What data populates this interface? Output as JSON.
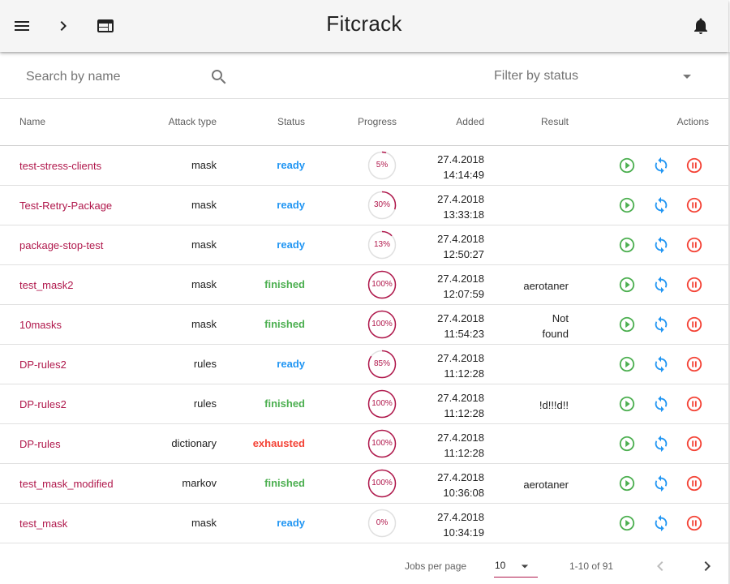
{
  "app": {
    "title": "Fitcrack"
  },
  "toolbar": {
    "menu_icon": "menu-icon",
    "expand_icon": "chevron-right-icon",
    "window_icon": "web-window-icon",
    "notifications_icon": "bell-icon"
  },
  "filters": {
    "search_placeholder": "Search by name",
    "search_value": "",
    "status_placeholder": "Filter by status"
  },
  "table": {
    "headers": {
      "name": "Name",
      "attack_type": "Attack type",
      "status": "Status",
      "progress": "Progress",
      "added": "Added",
      "result": "Result",
      "actions": "Actions"
    },
    "rows": [
      {
        "name": "test-stress-clients",
        "attack": "mask",
        "status": "ready",
        "progress": 5,
        "progress_label": "5%",
        "added_date": "27.4.2018",
        "added_time": "14:14:49",
        "result": [
          "",
          ""
        ]
      },
      {
        "name": "Test-Retry-Package",
        "attack": "mask",
        "status": "ready",
        "progress": 30,
        "progress_label": "30%",
        "added_date": "27.4.2018",
        "added_time": "13:33:18",
        "result": [
          "",
          ""
        ]
      },
      {
        "name": "package-stop-test",
        "attack": "mask",
        "status": "ready",
        "progress": 13,
        "progress_label": "13%",
        "added_date": "27.4.2018",
        "added_time": "12:50:27",
        "result": [
          "",
          ""
        ]
      },
      {
        "name": "test_mask2",
        "attack": "mask",
        "status": "finished",
        "progress": 100,
        "progress_label": "100%",
        "added_date": "27.4.2018",
        "added_time": "12:07:59",
        "result": [
          "aerotaner",
          ""
        ]
      },
      {
        "name": "10masks",
        "attack": "mask",
        "status": "finished",
        "progress": 100,
        "progress_label": "100%",
        "added_date": "27.4.2018",
        "added_time": "11:54:23",
        "result": [
          "Not",
          "found"
        ]
      },
      {
        "name": "DP-rules2",
        "attack": "rules",
        "status": "ready",
        "progress": 85,
        "progress_label": "85%",
        "added_date": "27.4.2018",
        "added_time": "11:12:28",
        "result": [
          "",
          ""
        ]
      },
      {
        "name": "DP-rules2",
        "attack": "rules",
        "status": "finished",
        "progress": 100,
        "progress_label": "100%",
        "added_date": "27.4.2018",
        "added_time": "11:12:28",
        "result": [
          "!d!!!d!!",
          ""
        ]
      },
      {
        "name": "DP-rules",
        "attack": "dictionary",
        "status": "exhausted",
        "progress": 100,
        "progress_label": "100%",
        "added_date": "27.4.2018",
        "added_time": "11:12:28",
        "result": [
          "",
          ""
        ]
      },
      {
        "name": "test_mask_modified",
        "attack": "markov",
        "status": "finished",
        "progress": 100,
        "progress_label": "100%",
        "added_date": "27.4.2018",
        "added_time": "10:36:08",
        "result": [
          "aerotaner",
          ""
        ]
      },
      {
        "name": "test_mask",
        "attack": "mask",
        "status": "ready",
        "progress": 0,
        "progress_label": "0%",
        "added_date": "27.4.2018",
        "added_time": "10:34:19",
        "result": [
          "",
          ""
        ]
      }
    ],
    "action_icons": [
      "play-circle-icon",
      "restart-icon",
      "pause-circle-icon"
    ]
  },
  "pagination": {
    "per_page_label": "Jobs per page",
    "per_page_value": "10",
    "range": "1-10 of 91",
    "prev_icon": "chevron-left-icon",
    "next_icon": "chevron-right-icon"
  },
  "colors": {
    "accent": "#b0174b",
    "ready": "#2196f3",
    "finished": "#4caf50",
    "exhausted": "#f44336",
    "progress_track": "#e0e0e0"
  }
}
